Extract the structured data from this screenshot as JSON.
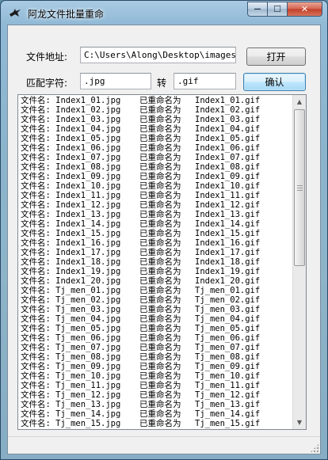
{
  "window": {
    "title": "阿龙文件批量重命",
    "minimize_symbol": "—",
    "maximize_symbol": "☐",
    "close_symbol": "✕",
    "icon": "bird-icon"
  },
  "form": {
    "path_label": "文件地址:",
    "path_value": "C:\\Users\\Along\\Desktop\\images",
    "open_button": "打开",
    "match_label": "匹配字符:",
    "match_value": ".jpg",
    "to_label": "转",
    "replace_value": ".gif",
    "confirm_button": "确认"
  },
  "log": {
    "rows": [
      [
        "文件名: Index1_01.jpg",
        "已重命名为",
        "Index1_01.gif"
      ],
      [
        "文件名: Index1_02.jpg",
        "已重命名为",
        "Index1_02.gif"
      ],
      [
        "文件名: Index1_03.jpg",
        "已重命名为",
        "Index1_03.gif"
      ],
      [
        "文件名: Index1_04.jpg",
        "已重命名为",
        "Index1_04.gif"
      ],
      [
        "文件名: Index1_05.jpg",
        "已重命名为",
        "Index1_05.gif"
      ],
      [
        "文件名: Index1_06.jpg",
        "已重命名为",
        "Index1_06.gif"
      ],
      [
        "文件名: Index1_07.jpg",
        "已重命名为",
        "Index1_07.gif"
      ],
      [
        "文件名: Index1_08.jpg",
        "已重命名为",
        "Index1_08.gif"
      ],
      [
        "文件名: Index1_09.jpg",
        "已重命名为",
        "Index1_09.gif"
      ],
      [
        "文件名: Index1_10.jpg",
        "已重命名为",
        "Index1_10.gif"
      ],
      [
        "文件名: Index1_11.jpg",
        "已重命名为",
        "Index1_11.gif"
      ],
      [
        "文件名: Index1_12.jpg",
        "已重命名为",
        "Index1_12.gif"
      ],
      [
        "文件名: Index1_13.jpg",
        "已重命名为",
        "Index1_13.gif"
      ],
      [
        "文件名: Index1_14.jpg",
        "已重命名为",
        "Index1_14.gif"
      ],
      [
        "文件名: Index1_15.jpg",
        "已重命名为",
        "Index1_15.gif"
      ],
      [
        "文件名: Index1_16.jpg",
        "已重命名为",
        "Index1_16.gif"
      ],
      [
        "文件名: Index1_17.jpg",
        "已重命名为",
        "Index1_17.gif"
      ],
      [
        "文件名: Index1_18.jpg",
        "已重命名为",
        "Index1_18.gif"
      ],
      [
        "文件名: Index1_19.jpg",
        "已重命名为",
        "Index1_19.gif"
      ],
      [
        "文件名: Index1_20.jpg",
        "已重命名为",
        "Index1_20.gif"
      ],
      [
        "文件名: Tj_men_01.jpg",
        "已重命名为",
        "Tj_men_01.gif"
      ],
      [
        "文件名: Tj_men_02.jpg",
        "已重命名为",
        "Tj_men_02.gif"
      ],
      [
        "文件名: Tj_men_03.jpg",
        "已重命名为",
        "Tj_men_03.gif"
      ],
      [
        "文件名: Tj_men_04.jpg",
        "已重命名为",
        "Tj_men_04.gif"
      ],
      [
        "文件名: Tj_men_05.jpg",
        "已重命名为",
        "Tj_men_05.gif"
      ],
      [
        "文件名: Tj_men_06.jpg",
        "已重命名为",
        "Tj_men_06.gif"
      ],
      [
        "文件名: Tj_men_07.jpg",
        "已重命名为",
        "Tj_men_07.gif"
      ],
      [
        "文件名: Tj_men_08.jpg",
        "已重命名为",
        "Tj_men_08.gif"
      ],
      [
        "文件名: Tj_men_09.jpg",
        "已重命名为",
        "Tj_men_09.gif"
      ],
      [
        "文件名: Tj_men_10.jpg",
        "已重命名为",
        "Tj_men_10.gif"
      ],
      [
        "文件名: Tj_men_11.jpg",
        "已重命名为",
        "Tj_men_11.gif"
      ],
      [
        "文件名: Tj_men_12.jpg",
        "已重命名为",
        "Tj_men_12.gif"
      ],
      [
        "文件名: Tj_men_13.jpg",
        "已重命名为",
        "Tj_men_13.gif"
      ],
      [
        "文件名: Tj_men_14.jpg",
        "已重命名为",
        "Tj_men_14.gif"
      ],
      [
        "文件名: Tj_men_15.jpg",
        "已重命名为",
        "Tj_men_15.gif"
      ]
    ]
  },
  "scrollbar": {
    "up_symbol": "▲",
    "down_symbol": "▼",
    "position": 0
  }
}
